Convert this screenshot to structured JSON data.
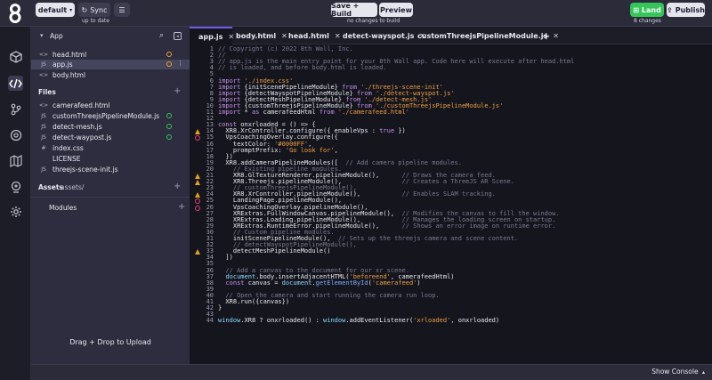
{
  "topbar": {
    "branch_label": "default",
    "sync_label": "Sync",
    "sync_status": "up to date",
    "save_label": "Save + Build",
    "preview_label": "Preview",
    "build_status": "no changes to build",
    "land_label": "Land",
    "land_status": "8 changes",
    "publish_label": "Publish"
  },
  "sidebar": {
    "app_header": "App",
    "app_files": [
      {
        "icon": "<>",
        "name": "head.html",
        "status": "modified"
      },
      {
        "icon": "JS",
        "name": "app.js",
        "status": "modified"
      },
      {
        "icon": "<>",
        "name": "body.html",
        "status": ""
      }
    ],
    "files_header": "Files",
    "files": [
      {
        "icon": "<>",
        "name": "camerafeed.html",
        "status": ""
      },
      {
        "icon": "JS",
        "name": "customThreejsPipelineModule.js",
        "status": "new"
      },
      {
        "icon": "JS",
        "name": "detect-mesh.js",
        "status": "new"
      },
      {
        "icon": "JS",
        "name": "detect-waypost.js",
        "status": "new"
      },
      {
        "icon": "#",
        "name": "index.css",
        "status": ""
      },
      {
        "icon": "",
        "name": "LICENSE",
        "status": ""
      },
      {
        "icon": "JS",
        "name": "threejs-scene-init.js",
        "status": ""
      }
    ],
    "assets_header": "Assets",
    "assets_path": "assets/",
    "modules_header": "Modules",
    "drop_label": "Drag + Drop to Upload"
  },
  "tabs": [
    "app.js",
    "body.html",
    "head.html",
    "detect-wayspot.js",
    "customThreejsPipelineModule.js"
  ],
  "footer": {
    "show_console": "Show Console"
  },
  "colors": {
    "accent": "#6c5ce7",
    "land": "#35c55a",
    "warning": "#e0a020",
    "error": "#e0407a"
  }
}
